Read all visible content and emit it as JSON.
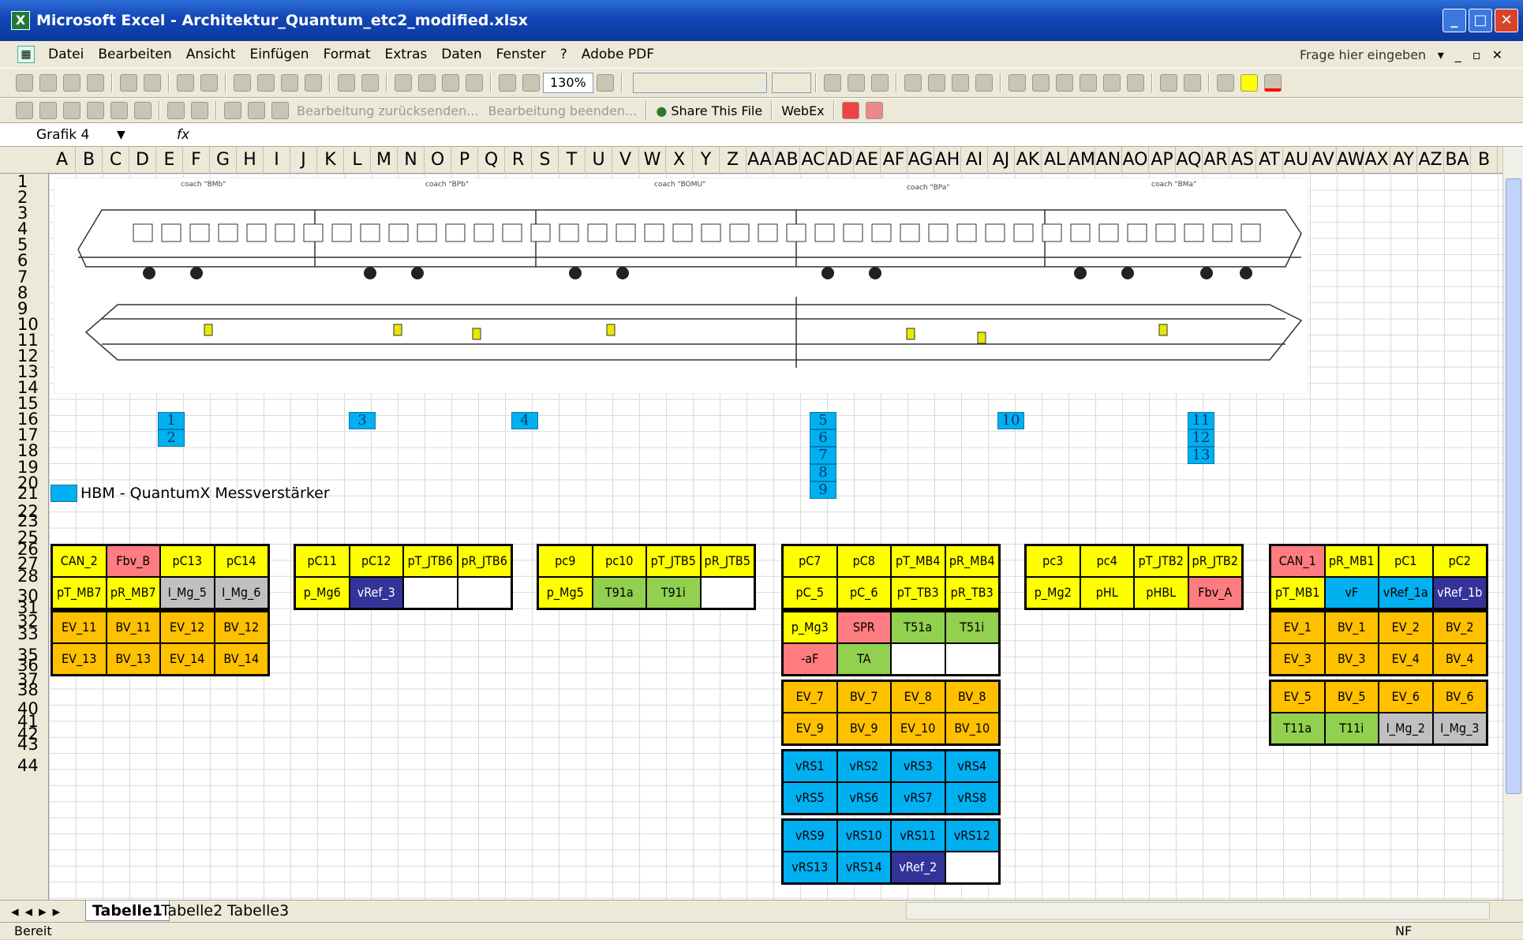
{
  "window": {
    "title": "Microsoft Excel - Architektur_Quantum_etc2_modified.xlsx",
    "buttons": [
      "_",
      "□",
      "✕"
    ]
  },
  "menu": {
    "items": [
      "Datei",
      "Bearbeiten",
      "Ansicht",
      "Einfügen",
      "Format",
      "Extras",
      "Daten",
      "Fenster",
      "?",
      "Adobe PDF"
    ],
    "ask_placeholder": "Frage hier eingeben"
  },
  "toolbar1": {
    "zoom": "130%"
  },
  "toolbar2": {
    "bearbeitung_zurueck": "Bearbeitung zurücksenden...",
    "bearbeitung_beenden": "Bearbeitung beenden...",
    "share": "Share This File",
    "webex": "WebEx"
  },
  "formula_bar": {
    "name_box": "Grafik 4",
    "fx": "fx"
  },
  "columns": [
    "A",
    "B",
    "C",
    "D",
    "E",
    "F",
    "G",
    "H",
    "I",
    "J",
    "K",
    "L",
    "M",
    "N",
    "O",
    "P",
    "Q",
    "R",
    "S",
    "T",
    "U",
    "V",
    "W",
    "X",
    "Y",
    "Z",
    "AA",
    "AB",
    "AC",
    "AD",
    "AE",
    "AF",
    "AG",
    "AH",
    "AI",
    "AJ",
    "AK",
    "AL",
    "AM",
    "AN",
    "AO",
    "AP",
    "AQ",
    "AR",
    "AS",
    "AT",
    "AU",
    "AV",
    "AW",
    "AX",
    "AY",
    "AZ",
    "BA",
    "B"
  ],
  "rows": [
    "1",
    "2",
    "3",
    "4",
    "5",
    "6",
    "7",
    "8",
    "9",
    "10",
    "11",
    "12",
    "13",
    "14",
    "15",
    "16",
    "17",
    "18",
    "19",
    "20",
    "21",
    "22",
    "23",
    "25",
    "26",
    "27",
    "28",
    "30",
    "31",
    "32",
    "33",
    "35",
    "36",
    "37",
    "38",
    "40",
    "41",
    "42",
    "43",
    "44"
  ],
  "drawing": {
    "coach_labels": [
      "coach \"BMb\"",
      "coach \"BPb\"",
      "coach \"BOMU\"",
      "coach \"BPa\"",
      "coach \"BMa\""
    ]
  },
  "modules": [
    "1",
    "2",
    "3",
    "4",
    "5",
    "6",
    "7",
    "8",
    "9",
    "10",
    "11",
    "12",
    "13"
  ],
  "legend": {
    "text": "HBM - QuantumX Messverstärker",
    "color": "#00b0f0"
  },
  "colors": {
    "yellow": "#ffff00",
    "red": "#ff7c80",
    "gray": "#c0c0c0",
    "navy": "#333399",
    "orange": "#ffc000",
    "green": "#92d050",
    "cyan": "#00b0f0",
    "white": "#ffffff"
  },
  "channel_groups": [
    {
      "cells": [
        [
          "CAN_2",
          "red:Fbv_B",
          "pC13",
          "pC14"
        ],
        [
          "pT_MB7",
          "pR_MB7",
          "gray:I_Mg_5",
          "gray:I_Mg_6"
        ]
      ],
      "fill": "yellow"
    },
    {
      "cells": [
        [
          "pC11",
          "pC12",
          "pT_JTB6",
          "pR_JTB6"
        ],
        [
          "p_Mg6",
          "navy:vRef_3",
          "white:",
          "white:"
        ]
      ],
      "fill": "yellow"
    },
    {
      "cells": [
        [
          "pc9",
          "pc10",
          "pT_JTB5",
          "pR_JTB5"
        ],
        [
          "p_Mg5",
          "green:T91a",
          "green:T91i",
          "white:"
        ]
      ],
      "fill": "yellow"
    },
    {
      "cells": [
        [
          "pC7",
          "pC8",
          "pT_MB4",
          "pR_MB4"
        ],
        [
          "pC_5",
          "pC_6",
          "pT_TB3",
          "pR_TB3"
        ]
      ],
      "fill": "yellow"
    },
    {
      "cells": [
        [
          "pc3",
          "pc4",
          "pT_JTB2",
          "pR_JTB2"
        ],
        [
          "p_Mg2",
          "pHL",
          "pHBL",
          "red:Fbv_A"
        ]
      ],
      "fill": "yellow"
    },
    {
      "cells": [
        [
          "red:CAN_1",
          "pR_MB1",
          "pC1",
          "pC2"
        ],
        [
          "pT_MB1",
          "cyan:vF",
          "cyan:vRef_1a",
          "navy:vRef_1b"
        ]
      ],
      "fill": "yellow"
    },
    {
      "cells": [
        [
          "EV_11",
          "BV_11",
          "EV_12",
          "BV_12"
        ],
        [
          "EV_13",
          "BV_13",
          "EV_14",
          "BV_14"
        ]
      ],
      "fill": "orange"
    },
    {
      "cells": [
        [
          "yellow:p_Mg3",
          "red:SPR",
          "green:T51a",
          "green:T51i"
        ],
        [
          "red:-aF",
          "green:TA",
          "white:",
          "white:"
        ]
      ],
      "fill": "yellow"
    },
    {
      "cells": [
        [
          "EV_1",
          "BV_1",
          "EV_2",
          "BV_2"
        ],
        [
          "EV_3",
          "BV_3",
          "EV_4",
          "BV_4"
        ]
      ],
      "fill": "orange"
    },
    {
      "cells": [
        [
          "EV_7",
          "BV_7",
          "EV_8",
          "BV_8"
        ],
        [
          "EV_9",
          "BV_9",
          "EV_10",
          "BV_10"
        ]
      ],
      "fill": "orange"
    },
    {
      "cells": [
        [
          "EV_5",
          "BV_5",
          "EV_6",
          "BV_6"
        ],
        [
          "green:T11a",
          "green:T11i",
          "gray:I_Mg_2",
          "gray:I_Mg_3"
        ]
      ],
      "fill": "orange"
    },
    {
      "cells": [
        [
          "vRS1",
          "vRS2",
          "vRS3",
          "vRS4"
        ],
        [
          "vRS5",
          "vRS6",
          "vRS7",
          "vRS8"
        ]
      ],
      "fill": "cyan"
    },
    {
      "cells": [
        [
          "vRS9",
          "vRS10",
          "vRS11",
          "vRS12"
        ],
        [
          "vRS13",
          "vRS14",
          "navy:vRef_2",
          "white:"
        ]
      ],
      "fill": "cyan"
    }
  ],
  "sheet_tabs": [
    "Tabelle1",
    "Tabelle2",
    "Tabelle3"
  ],
  "status": {
    "left": "Bereit",
    "right": "NF"
  }
}
